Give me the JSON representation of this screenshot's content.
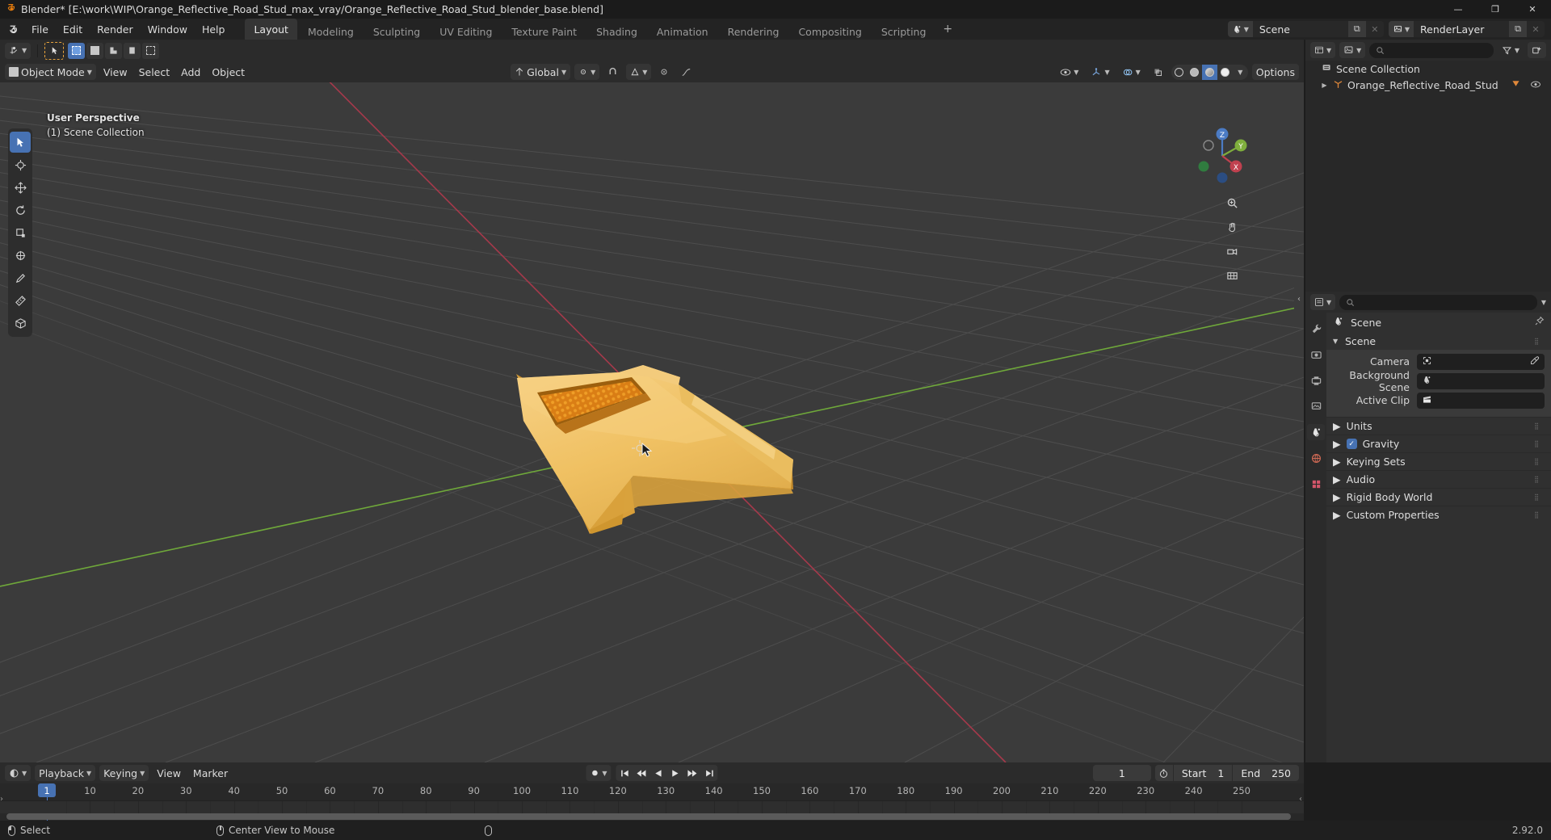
{
  "window": {
    "title": "Blender* [E:\\work\\WIP\\Orange_Reflective_Road_Stud_max_vray/Orange_Reflective_Road_Stud_blender_base.blend]",
    "app_icon": "blender-logo-icon",
    "minimize": "—",
    "maximize": "❐",
    "close": "✕"
  },
  "topbar": {
    "menus": [
      "File",
      "Edit",
      "Render",
      "Window",
      "Help"
    ],
    "tabs": [
      {
        "label": "Layout",
        "active": true
      },
      {
        "label": "Modeling",
        "active": false
      },
      {
        "label": "Sculpting",
        "active": false
      },
      {
        "label": "UV Editing",
        "active": false
      },
      {
        "label": "Texture Paint",
        "active": false
      },
      {
        "label": "Shading",
        "active": false
      },
      {
        "label": "Animation",
        "active": false
      },
      {
        "label": "Rendering",
        "active": false
      },
      {
        "label": "Compositing",
        "active": false
      },
      {
        "label": "Scripting",
        "active": false
      }
    ],
    "add_tab": "+",
    "scene": {
      "icon": "scene-icon",
      "name": "Scene",
      "new_btn": "⧉",
      "unlink_btn": "✕"
    },
    "view_layer": {
      "icon": "view-layer-icon",
      "name": "RenderLayer",
      "new_btn": "⧉",
      "unlink_btn": "✕"
    }
  },
  "viewport": {
    "header": {
      "editor_type": "editor-type-3d-view",
      "cursor_tool": "select-box-tool",
      "select_modes": [
        "set",
        "extend",
        "subtract",
        "invert",
        "intersect"
      ],
      "mode": "Object Mode",
      "menus": [
        "View",
        "Select",
        "Add",
        "Object"
      ],
      "transform_orientation": "Global",
      "snap": "snapping-magnet",
      "proportional": "proportional-editing",
      "options_label": "Options"
    },
    "overlay_text": {
      "perspective": "User Perspective",
      "collection": "(1) Scene Collection"
    },
    "tools": [
      "tweak-select-tool",
      "cursor-tool",
      "move-tool",
      "rotate-tool",
      "scale-tool",
      "transform-tool",
      "annotate-tool",
      "measure-tool",
      "add-cube-tool"
    ],
    "gizmo_axes": {
      "x": "X",
      "y": "Y",
      "z": "Z"
    },
    "nav_buttons": [
      "zoom-icon",
      "pan-hand-icon",
      "camera-view-icon",
      "toggle-ortho-icon"
    ],
    "object_color_body": "#f0c163",
    "object_color_inset": "#e08820",
    "grid_color": "#565656",
    "axis_x_color": "#a6394b",
    "axis_y_color": "#6fa83a"
  },
  "outliner": {
    "editor_type": "editor-type-outliner",
    "display_mode": "view-layer-icon",
    "search_placeholder": "",
    "filter_icon": "filter-funnel-icon",
    "new_collection_icon": "new-collection-icon",
    "rows": [
      {
        "name": "Scene Collection",
        "icon": "scene-collection-icon",
        "indent": 0,
        "expandable": false
      },
      {
        "name": "Orange_Reflective_Road_Stud",
        "icon": "mesh-object-icon",
        "indent": 1,
        "expandable": true,
        "modifier": "mesh-data-icon",
        "visible_icon": "eye-icon"
      }
    ]
  },
  "properties": {
    "editor_type": "editor-type-properties",
    "search_placeholder": "",
    "tabs": [
      "tool-tab",
      "render-tab",
      "output-tab",
      "view-layer-tab",
      "scene-tab",
      "world-tab",
      "texture-tab"
    ],
    "active_tab_index": 4,
    "breadcrumb": "Scene",
    "breadcrumb_icon": "scene-icon",
    "pin_icon": "pin-icon",
    "panels": [
      {
        "name": "Scene",
        "open": true,
        "fields": [
          {
            "label": "Camera",
            "value": "",
            "icon": "camera-icon",
            "extra": "eyedropper-icon"
          },
          {
            "label": "Background Scene",
            "value": "",
            "icon": "scene-icon",
            "extra": ""
          },
          {
            "label": "Active Clip",
            "value": "",
            "icon": "clip-icon",
            "extra": ""
          }
        ]
      },
      {
        "name": "Units",
        "open": false,
        "checkbox": null
      },
      {
        "name": "Gravity",
        "open": false,
        "checkbox": true
      },
      {
        "name": "Keying Sets",
        "open": false,
        "checkbox": null
      },
      {
        "name": "Audio",
        "open": false,
        "checkbox": null
      },
      {
        "name": "Rigid Body World",
        "open": false,
        "checkbox": null
      },
      {
        "name": "Custom Properties",
        "open": false,
        "checkbox": null
      }
    ]
  },
  "timeline": {
    "editor_type": "editor-type-timeline",
    "menus": [
      "Playback",
      "Keying",
      "View",
      "Marker"
    ],
    "auto_key_icon": "record-dot-icon",
    "transport": [
      "jump-start",
      "prev-keyframe",
      "play-reverse",
      "play",
      "next-keyframe",
      "jump-end"
    ],
    "current_frame": "1",
    "start_label": "Start",
    "start_value": "1",
    "end_label": "End",
    "end_value": "250",
    "timer_icon": "stopwatch-icon",
    "ruler_ticks": [
      10,
      20,
      30,
      40,
      50,
      60,
      70,
      80,
      90,
      100,
      110,
      120,
      130,
      140,
      150,
      160,
      170,
      180,
      190,
      200,
      210,
      220,
      230,
      240,
      250
    ],
    "playhead_frame": 1,
    "playhead_label": "1"
  },
  "statusbar": {
    "items": [
      {
        "icon": "mouse-left-icon",
        "label": "Select"
      },
      {
        "icon": "mouse-middle-icon",
        "label": "Center View to Mouse"
      },
      {
        "icon": "mouse-right-icon",
        "label": ""
      }
    ],
    "version": "2.92.0"
  }
}
